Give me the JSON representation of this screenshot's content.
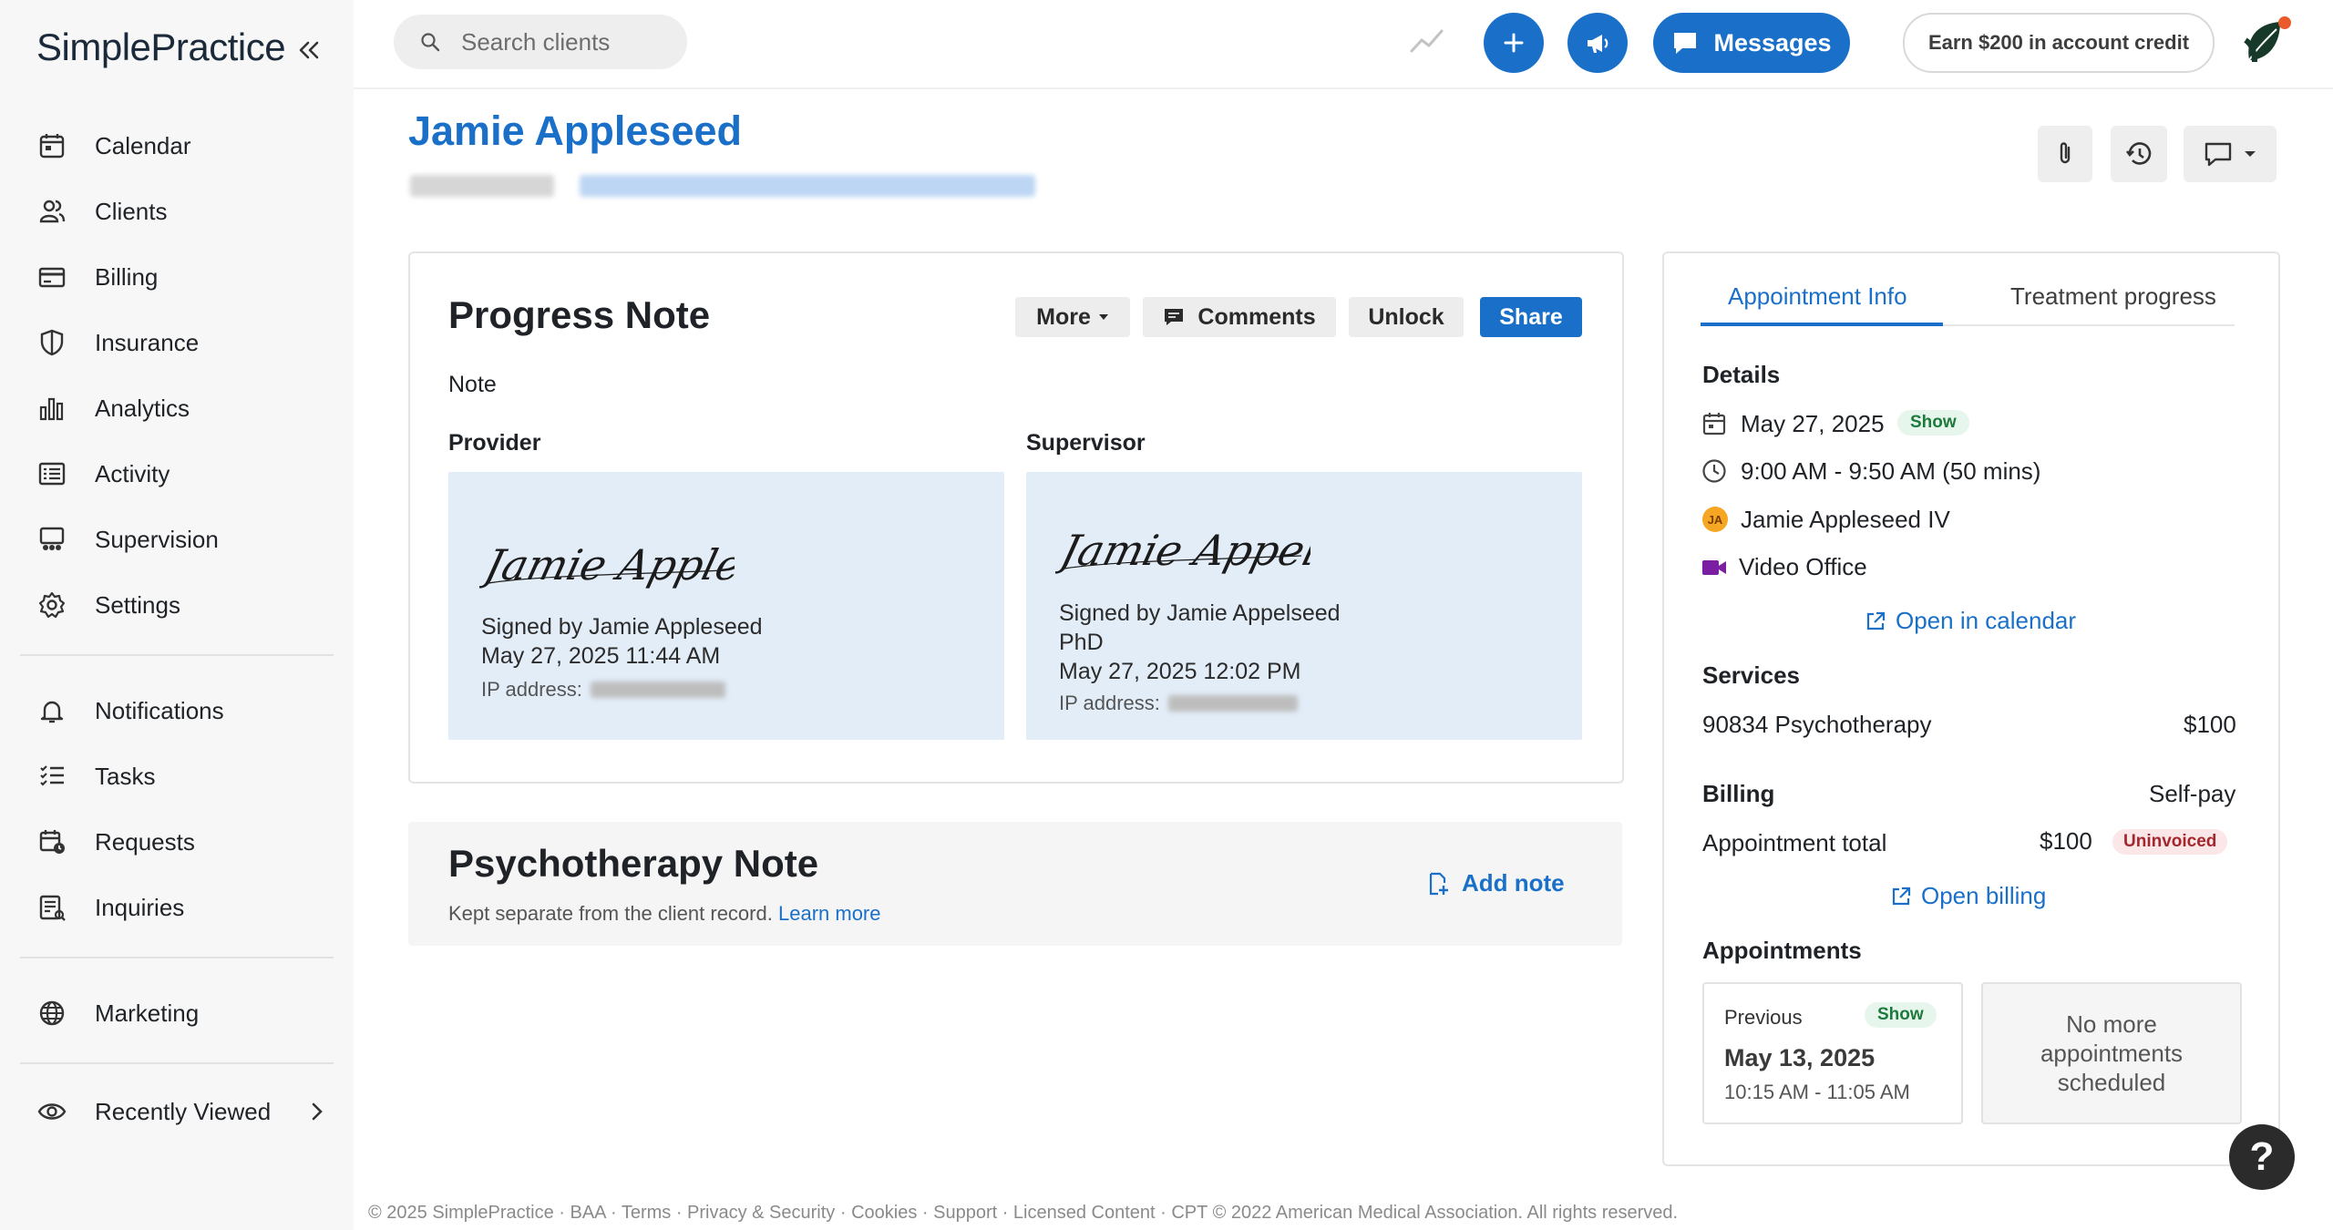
{
  "app": {
    "logo": "SimplePractice"
  },
  "sidebar": {
    "items": [
      {
        "label": "Calendar",
        "icon": "calendar-icon"
      },
      {
        "label": "Clients",
        "icon": "clients-icon"
      },
      {
        "label": "Billing",
        "icon": "billing-icon"
      },
      {
        "label": "Insurance",
        "icon": "shield-icon"
      },
      {
        "label": "Analytics",
        "icon": "bar-chart-icon"
      },
      {
        "label": "Activity",
        "icon": "activity-icon"
      },
      {
        "label": "Supervision",
        "icon": "supervision-icon"
      },
      {
        "label": "Settings",
        "icon": "gear-icon"
      },
      {
        "label": "Notifications",
        "icon": "bell-icon"
      },
      {
        "label": "Tasks",
        "icon": "tasks-icon"
      },
      {
        "label": "Requests",
        "icon": "requests-icon"
      },
      {
        "label": "Inquiries",
        "icon": "inquiries-icon"
      },
      {
        "label": "Marketing",
        "icon": "globe-icon"
      },
      {
        "label": "Recently Viewed",
        "icon": "eye-icon"
      }
    ]
  },
  "topbar": {
    "search_placeholder": "Search clients",
    "messages_label": "Messages",
    "earn_label": "Earn $200 in account credit"
  },
  "client": {
    "name": "Jamie Appleseed"
  },
  "note": {
    "title": "Progress Note",
    "more_label": "More",
    "comments_label": "Comments",
    "unlock_label": "Unlock",
    "share_label": "Share",
    "type_label": "Note",
    "provider_heading": "Provider",
    "supervisor_heading": "Supervisor",
    "provider": {
      "signature": "Jamie Appleseed",
      "signed_by": "Signed by Jamie Appleseed",
      "signed_at": "May 27, 2025 11:44 AM",
      "ip_label": "IP address:"
    },
    "supervisor": {
      "signature": "Jamie Appelseed",
      "signed_by": "Signed by Jamie Appelseed",
      "credential": "PhD",
      "signed_at": "May 27, 2025 12:02 PM",
      "ip_label": "IP address:"
    }
  },
  "psychotherapy": {
    "title": "Psychotherapy Note",
    "subtitle": "Kept separate from the client record.",
    "learn_more": "Learn more",
    "add_note": "Add note"
  },
  "panel": {
    "tabs": [
      "Appointment Info",
      "Treatment progress"
    ],
    "details_heading": "Details",
    "date": "May 27, 2025",
    "status": "Show",
    "time": "9:00 AM - 9:50 AM (50 mins)",
    "client_initials": "JA",
    "client": "Jamie Appleseed IV",
    "location": "Video Office",
    "open_calendar": "Open in calendar",
    "services_heading": "Services",
    "service_name": "90834 Psychotherapy",
    "service_price": "$100",
    "billing_heading": "Billing",
    "billing_type": "Self-pay",
    "appt_total_label": "Appointment total",
    "appt_total": "$100",
    "invoice_status": "Uninvoiced",
    "open_billing": "Open billing",
    "appointments_heading": "Appointments",
    "previous": {
      "label": "Previous",
      "status": "Show",
      "date": "May 13, 2025",
      "time": "10:15 AM - 11:05 AM"
    },
    "no_more": "No more appointments scheduled"
  },
  "footer": "© 2025 SimplePractice · BAA · Terms · Privacy & Security · Cookies · Support · Licensed Content · CPT © 2022 American Medical Association. All rights reserved.",
  "help_label": "?",
  "colors": {
    "accent": "#1a70c9",
    "show_badge": "#1e7a3c",
    "uninvoiced_badge": "#a3272d",
    "video": "#7b1fa2"
  }
}
